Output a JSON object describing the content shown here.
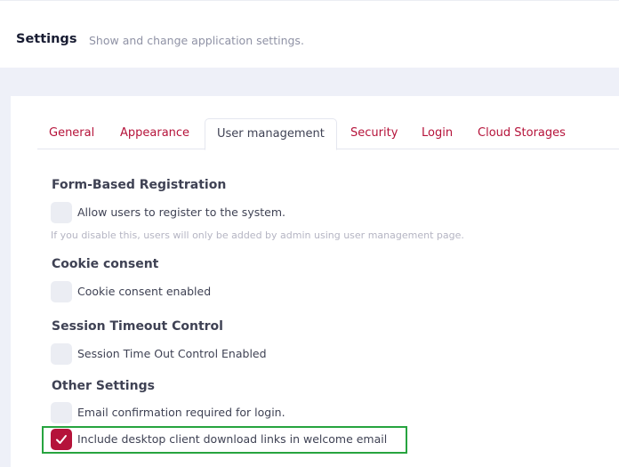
{
  "header": {
    "title": "Settings",
    "subtitle": "Show and change application settings."
  },
  "tabs": [
    {
      "label": "General",
      "active": false
    },
    {
      "label": "Appearance",
      "active": false
    },
    {
      "label": "User management",
      "active": true
    },
    {
      "label": "Security",
      "active": false
    },
    {
      "label": "Login",
      "active": false
    },
    {
      "label": "Cloud Storages",
      "active": false
    }
  ],
  "sections": {
    "registration": {
      "title": "Form-Based Registration",
      "allow_label": "Allow users to register to the system.",
      "allow_checked": false,
      "hint": "If you disable this, users will only be added by admin using user management page."
    },
    "cookie": {
      "title": "Cookie consent",
      "enabled_label": "Cookie consent enabled",
      "enabled_checked": false
    },
    "session": {
      "title": "Session Timeout Control",
      "enabled_label": "Session Time Out Control Enabled",
      "enabled_checked": false
    },
    "other": {
      "title": "Other Settings",
      "email_confirm_label": "Email confirmation required for login.",
      "email_confirm_checked": false,
      "desktop_links_label": "Include desktop client download links in welcome email",
      "desktop_links_checked": true
    }
  },
  "colors": {
    "accent": "#b5133a",
    "highlight": "#27a43f",
    "background": "#eef0f8"
  }
}
